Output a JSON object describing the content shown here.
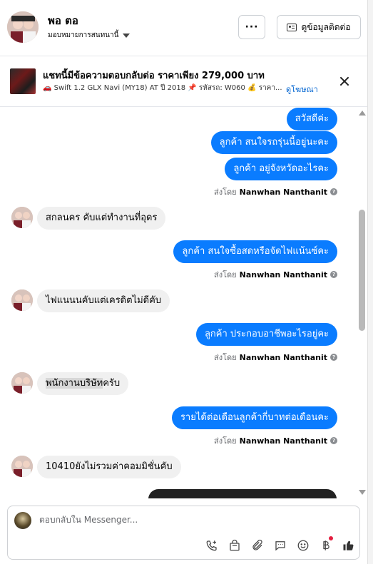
{
  "header": {
    "contact_name": "พอ ตอ",
    "assign_label": "มอบหมายการสนทนานี้",
    "more_label": "···",
    "info_button_label": "ดูข้อมูลติดต่อ"
  },
  "ad": {
    "title": "แชทนี้มีข้อความตอบกลับต่อ ราคาเพียง 279,000 บาท",
    "subtitle": "🚗 Swift 1.2 GLX Navi (MY18) AT ปี 2018 📌 รหัสรถ: W060 💰 ราคา...",
    "view_ad_link": "ดูโฆษณา"
  },
  "messages": {
    "out1": "สวัสดีค่ะ",
    "out2": "ลูกค้า สนใจรถรุ่นนี้อยู่นะคะ",
    "out3": "ลูกค้า อยู่จังหวัดอะไรคะ",
    "in1": "สกลนคร คับแต่ทำงานที่อุดร",
    "out4": "ลูกค้า สนใจซื้อสดหรือจัดไฟแน้นซ์คะ",
    "in2": "ไฟแนนนคับแต่เครดิตไม่ดีคับ",
    "out5": "ลูกค้า  ประกอบอาชีพอะไรอยู่คะ",
    "in3_highlight": "พนักงานบริษัท",
    "in3_rest": "ครับ",
    "out6": "รายได้ต่อเดือนลูกค้ากี่บาทต่อเดือนคะ",
    "in4": "10410ยังไม่รวมค่าคอมมิชั่นคับ"
  },
  "sent_by": {
    "prefix": "ส่งโดย",
    "name": "Nanwhan Nanthanit",
    "info_glyph": "?"
  },
  "composer": {
    "placeholder": "ตอบกลับใน Messenger..."
  },
  "colors": {
    "accent_blue": "#0a7cff",
    "incoming_bg": "#f0f0f0",
    "notification_red": "#e41e3f"
  }
}
